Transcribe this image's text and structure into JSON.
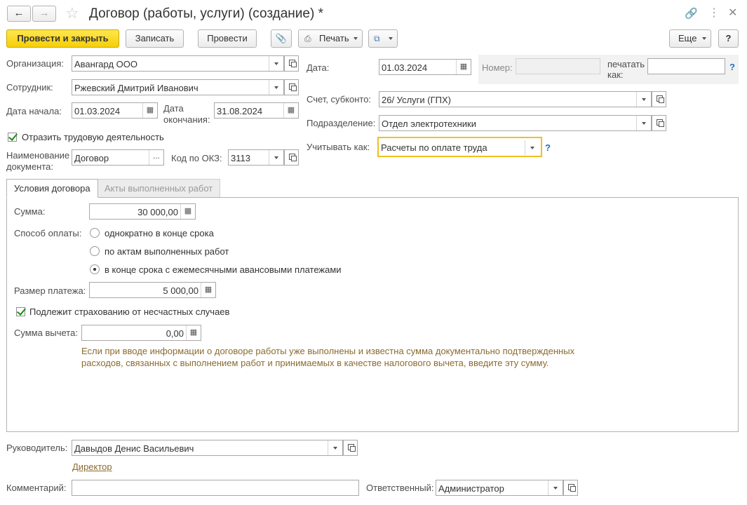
{
  "window": {
    "title": "Договор (работы, услуги) (создание) *"
  },
  "toolbar": {
    "post_close": "Провести и закрыть",
    "save": "Записать",
    "post": "Провести",
    "print": "Печать",
    "more": "Еще",
    "help": "?"
  },
  "form": {
    "org_label": "Организация:",
    "org_value": "Авангард ООО",
    "employee_label": "Сотрудник:",
    "employee_value": "Ржевский Дмитрий Иванович",
    "start_label": "Дата начала:",
    "start_value": "01.03.2024",
    "end_label_1": "Дата",
    "end_label_2": "окончания:",
    "end_value": "31.08.2024",
    "reflect_label": "Отразить трудовую деятельность",
    "docname_label_1": "Наименование",
    "docname_label_2": "документа:",
    "docname_value": "Договор",
    "okz_label": "Код по ОКЗ:",
    "okz_value": "3113",
    "date_label": "Дата:",
    "date_value": "01.03.2024",
    "number_label": "Номер:",
    "number_value": "",
    "print_as_label_1": "печатать",
    "print_as_label_2": "как:",
    "print_as_value": "",
    "account_label": "Счет, субконто:",
    "account_value": "26/ Услуги (ГПХ)",
    "dept_label": "Подразделение:",
    "dept_value": "Отдел электротехники",
    "account_as_label": "Учитывать как:",
    "account_as_value": "Расчеты по оплате труда"
  },
  "tabs": [
    {
      "label": "Условия договора"
    },
    {
      "label": "Акты выполненных работ"
    }
  ],
  "terms": {
    "sum_label": "Сумма:",
    "sum_value": "30 000,00",
    "pay_method_label": "Способ оплаты:",
    "pay_options": [
      {
        "label": "однократно в конце срока"
      },
      {
        "label": "по актам выполненных работ"
      },
      {
        "label": "в конце срока с ежемесячными авансовыми платежами"
      }
    ],
    "payment_label": "Размер платежа:",
    "payment_value": "5 000,00",
    "insurance_label": "Подлежит страхованию от несчастных случаев",
    "deduction_label": "Сумма вычета:",
    "deduction_value": "0,00",
    "hint_line1": "Если при вводе информации о договоре работы уже выполнены и известна сумма документально подтвержденных",
    "hint_line2": "расходов, связанных с выполнением работ и принимаемых в качестве налогового вычета, введите эту сумму."
  },
  "footer": {
    "manager_label": "Руководитель:",
    "manager_value": "Давыдов Денис Васильевич",
    "position_link": "Директор",
    "comment_label": "Комментарий:",
    "comment_value": "",
    "responsible_label": "Ответственный:",
    "responsible_value": "Администратор"
  },
  "colors": {
    "primary_button": "#f5cf0a",
    "highlight_border": "#f0c020",
    "link": "#8b6b2f",
    "hint": "#8b6b2f"
  }
}
